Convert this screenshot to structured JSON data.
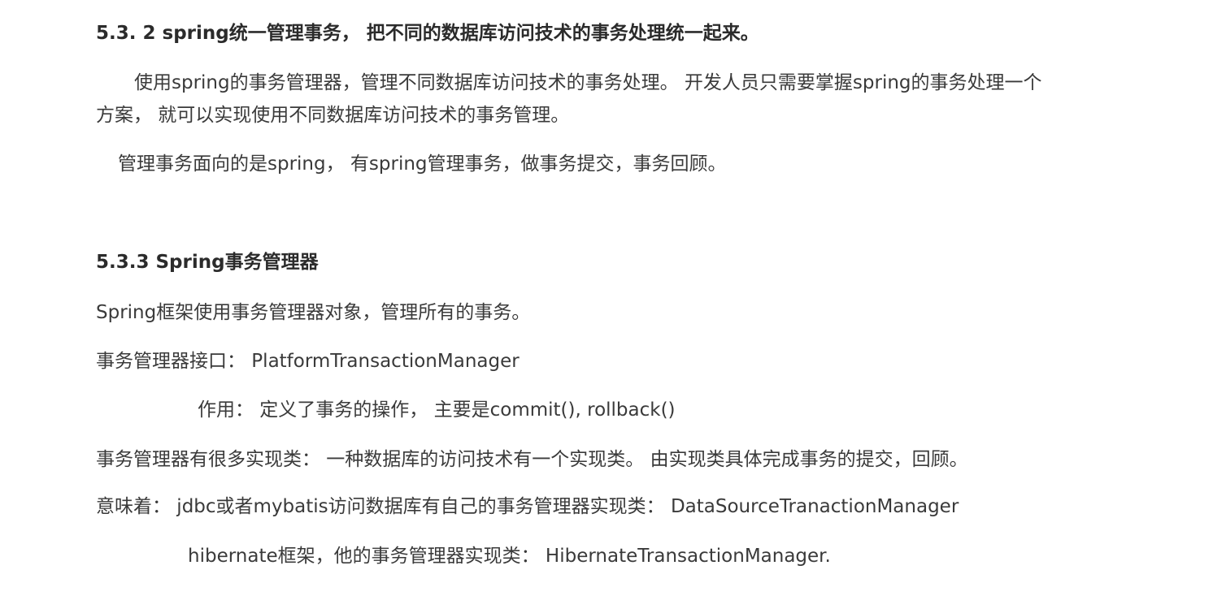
{
  "section_532": {
    "heading": "5.3. 2 spring统一管理事务， 把不同的数据库访问技术的事务处理统一起来。",
    "para1_line1": "使用spring的事务管理器，管理不同数据库访问技术的事务处理。 开发人员只需要掌握spring的事务处理一个",
    "para1_line2": "方案， 就可以实现使用不同数据库访问技术的事务管理。",
    "para2": "管理事务面向的是spring， 有spring管理事务，做事务提交，事务回顾。"
  },
  "section_533": {
    "heading": "5.3.3 Spring事务管理器",
    "line1": "Spring框架使用事务管理器对象，管理所有的事务。",
    "line2": "事务管理器接口：  PlatformTransactionManager",
    "line3": "作用：  定义了事务的操作，  主要是commit(), rollback()",
    "line4": "事务管理器有很多实现类：  一种数据库的访问技术有一个实现类。 由实现类具体完成事务的提交，回顾。",
    "line5": "意味着：  jdbc或者mybatis访问数据库有自己的事务管理器实现类：   DataSourceTranactionManager",
    "line6": "hibernate框架，他的事务管理器实现类：   HibernateTransactionManager."
  }
}
